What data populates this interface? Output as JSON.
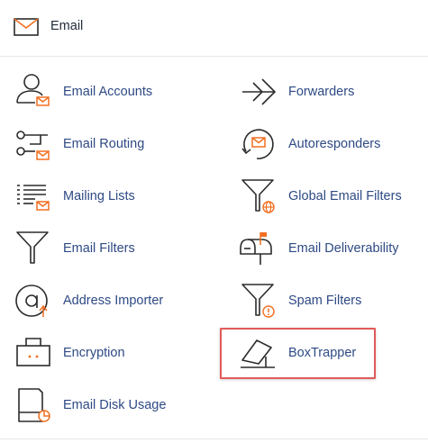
{
  "header": {
    "title": "Email",
    "icon": "envelope-icon"
  },
  "colors": {
    "link": "#2e4a84",
    "accent": "#f26f21",
    "icon_stroke": "#2b2b2b",
    "highlight": "#e15a5a"
  },
  "left_items": [
    {
      "label": "Email Accounts",
      "icon": "email-accounts-icon"
    },
    {
      "label": "Email Routing",
      "icon": "email-routing-icon"
    },
    {
      "label": "Mailing Lists",
      "icon": "mailing-lists-icon"
    },
    {
      "label": "Email Filters",
      "icon": "email-filters-icon"
    },
    {
      "label": "Address Importer",
      "icon": "address-importer-icon"
    },
    {
      "label": "Encryption",
      "icon": "encryption-icon"
    },
    {
      "label": "Email Disk Usage",
      "icon": "email-disk-usage-icon"
    }
  ],
  "right_items": [
    {
      "label": "Forwarders",
      "icon": "forwarders-icon"
    },
    {
      "label": "Autoresponders",
      "icon": "autoresponders-icon"
    },
    {
      "label": "Global Email Filters",
      "icon": "global-email-filters-icon"
    },
    {
      "label": "Email Deliverability",
      "icon": "email-deliverability-icon"
    },
    {
      "label": "Spam Filters",
      "icon": "spam-filters-icon"
    },
    {
      "label": "BoxTrapper",
      "icon": "boxtrapper-icon"
    }
  ]
}
